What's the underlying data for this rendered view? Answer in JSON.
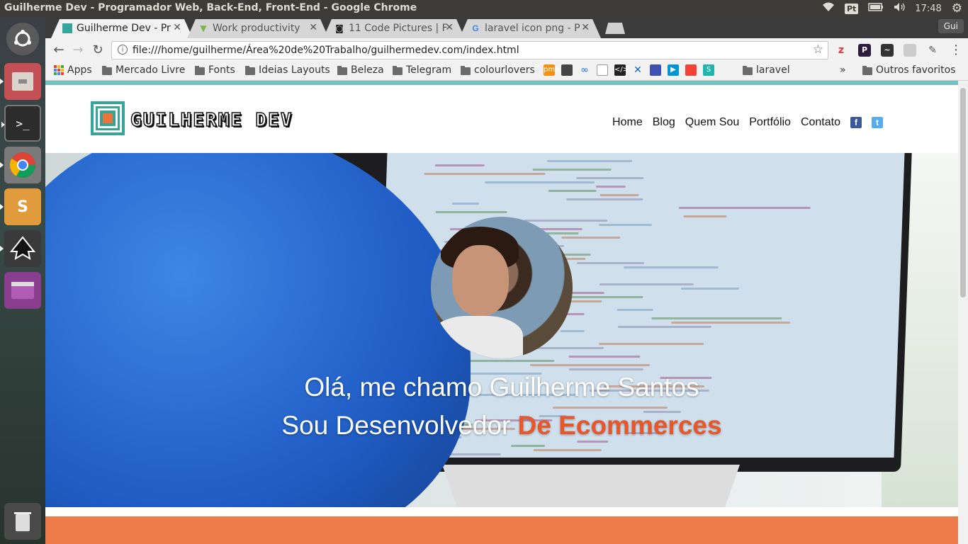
{
  "os": {
    "window_title": "Guilherme Dev - Programador Web, Back-End, Front-End - Google Chrome",
    "keyboard_layout": "Pt",
    "clock": "17:48"
  },
  "browser": {
    "tabs": [
      {
        "label": "Guilherme Dev - Pr",
        "active": true
      },
      {
        "label": "Work productivity",
        "active": false
      },
      {
        "label": "11 Code Pictures | F",
        "active": false
      },
      {
        "label": "laravel icon png - P",
        "active": false
      }
    ],
    "profile": "Gui",
    "url": "file:///home/guilherme/Área%20de%20Trabalho/guilhermedev.com/index.html",
    "bookmarks": [
      {
        "label": "Apps",
        "type": "apps"
      },
      {
        "label": "Mercado Livre",
        "type": "folder"
      },
      {
        "label": "Fonts",
        "type": "folder"
      },
      {
        "label": "Ideias Layouts",
        "type": "folder"
      },
      {
        "label": "Beleza",
        "type": "folder"
      },
      {
        "label": "Telegram",
        "type": "folder"
      },
      {
        "label": "colourlovers",
        "type": "folder"
      },
      {
        "label": "laravel",
        "type": "folder"
      }
    ],
    "other_bookmarks": "Outros favoritos",
    "overflow": "»"
  },
  "site": {
    "logo_text": "GUILHERME DEV",
    "nav": [
      "Home",
      "Blog",
      "Quem Sou",
      "Portfólio",
      "Contato"
    ],
    "social": {
      "facebook": "f",
      "twitter": "t"
    },
    "hero": {
      "line1": "Olá, me chamo Guilherme Santos",
      "line2_prefix": "Sou Desenvolvedor",
      "line2_accent": "De Ecommerces"
    },
    "colors": {
      "accent": "#e8562a",
      "teal": "#6ec3c0",
      "band": "#ee7b4c",
      "logo": "#35a59a"
    }
  }
}
